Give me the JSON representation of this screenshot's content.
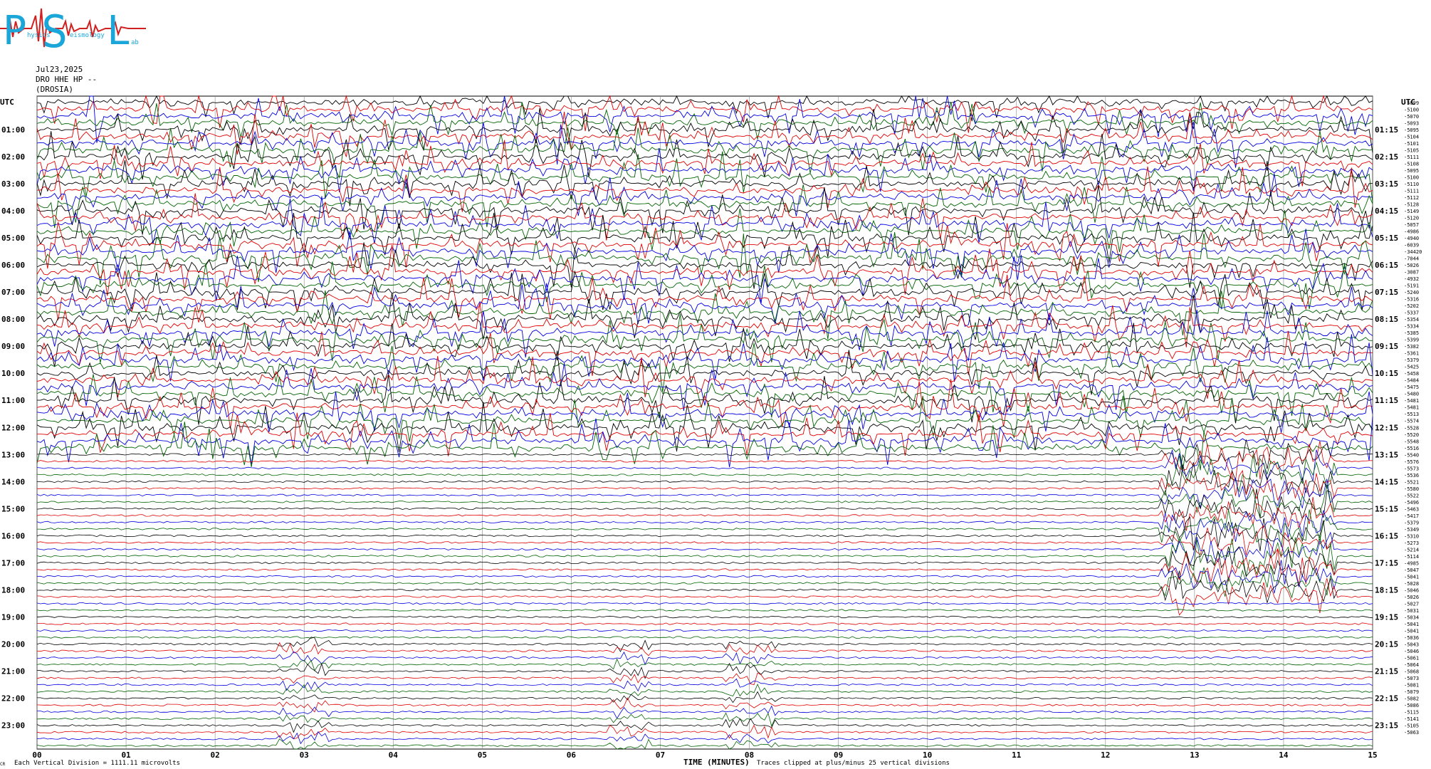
{
  "logo": {
    "letters": [
      "P",
      "S",
      "L"
    ],
    "words": [
      "hysics",
      "eismology",
      "ab"
    ]
  },
  "header": {
    "date": "Jul23,2025",
    "channel": "DRO HHE HP --",
    "station": "(DROSIA)"
  },
  "utc_left": "UTC",
  "utc_right": "UTC",
  "footer": {
    "corner_mark": "CR",
    "vertical_division": "Each Vertical Division = 1111.11 microvolts",
    "x_title": "TIME (MINUTES)",
    "clip_note": "Traces clipped at plus/minus 25 vertical divisions"
  },
  "chart_data": {
    "type": "line",
    "title": "",
    "xlabel": "TIME (MINUTES)",
    "x_range": [
      0,
      15
    ],
    "x_ticks": [
      "00",
      "01",
      "02",
      "03",
      "04",
      "05",
      "06",
      "07",
      "08",
      "09",
      "10",
      "11",
      "12",
      "13",
      "14",
      "15"
    ],
    "rows_per_hour": 4,
    "row_count": 96,
    "trace_colors": [
      "#000000",
      "#e00000",
      "#0000e0",
      "#006400"
    ],
    "left_hour_labels": [
      "01:00",
      "02:00",
      "03:00",
      "04:00",
      "05:00",
      "06:00",
      "07:00",
      "08:00",
      "09:00",
      "10:00",
      "11:00",
      "12:00",
      "13:00",
      "14:00",
      "15:00",
      "16:00",
      "17:00",
      "18:00",
      "19:00",
      "20:00",
      "21:00",
      "22:00",
      "23:00"
    ],
    "right_hour_labels": [
      "01:15",
      "02:15",
      "03:15",
      "04:15",
      "05:15",
      "06:15",
      "07:15",
      "08:15",
      "09:15",
      "10:15",
      "11:15",
      "12:15",
      "13:15",
      "14:15",
      "15:15",
      "16:15",
      "17:15",
      "18:15",
      "19:15",
      "20:15",
      "21:15",
      "22:15",
      "23:15"
    ],
    "row_offsets": [
      "-5099",
      "-5100",
      "-5070",
      "-5093",
      "-5095",
      "-5104",
      "-5101",
      "-5105",
      "-5111",
      "-5108",
      "-5095",
      "-5100",
      "-5110",
      "-5111",
      "-5112",
      "-5128",
      "-5149",
      "-5120",
      "-5057",
      "-4986",
      "-4940",
      "-6039",
      "-34420",
      "-7044",
      "-5026",
      "-3087",
      "-4932",
      "-5191",
      "-5240",
      "-5316",
      "-5202",
      "-5337",
      "-5354",
      "-5334",
      "-5385",
      "-5399",
      "-5382",
      "-5361",
      "-5379",
      "-5425",
      "-5458",
      "-5484",
      "-5475",
      "-5480",
      "-5481",
      "-5481",
      "-5513",
      "-5574",
      "-5528",
      "-5520",
      "-5548",
      "-5516",
      "-5540",
      "-5576",
      "-5573",
      "-5536",
      "-5521",
      "-5580",
      "-5522",
      "-5496",
      "-5463",
      "-5417",
      "-5379",
      "-5349",
      "-5310",
      "-5273",
      "-5214",
      "-5114",
      "-4985",
      "-5047",
      "-5041",
      "-5028",
      "-5046",
      "-5026",
      "-5027",
      "-5031",
      "-5034",
      "-5041",
      "-5041",
      "-5036",
      "-5043",
      "-5046",
      "-5061",
      "-5064",
      "-5068",
      "-5073",
      "-5081",
      "-5079",
      "-5082",
      "-5086",
      "-5115",
      "-5141",
      "-5105",
      "-5063"
    ]
  }
}
